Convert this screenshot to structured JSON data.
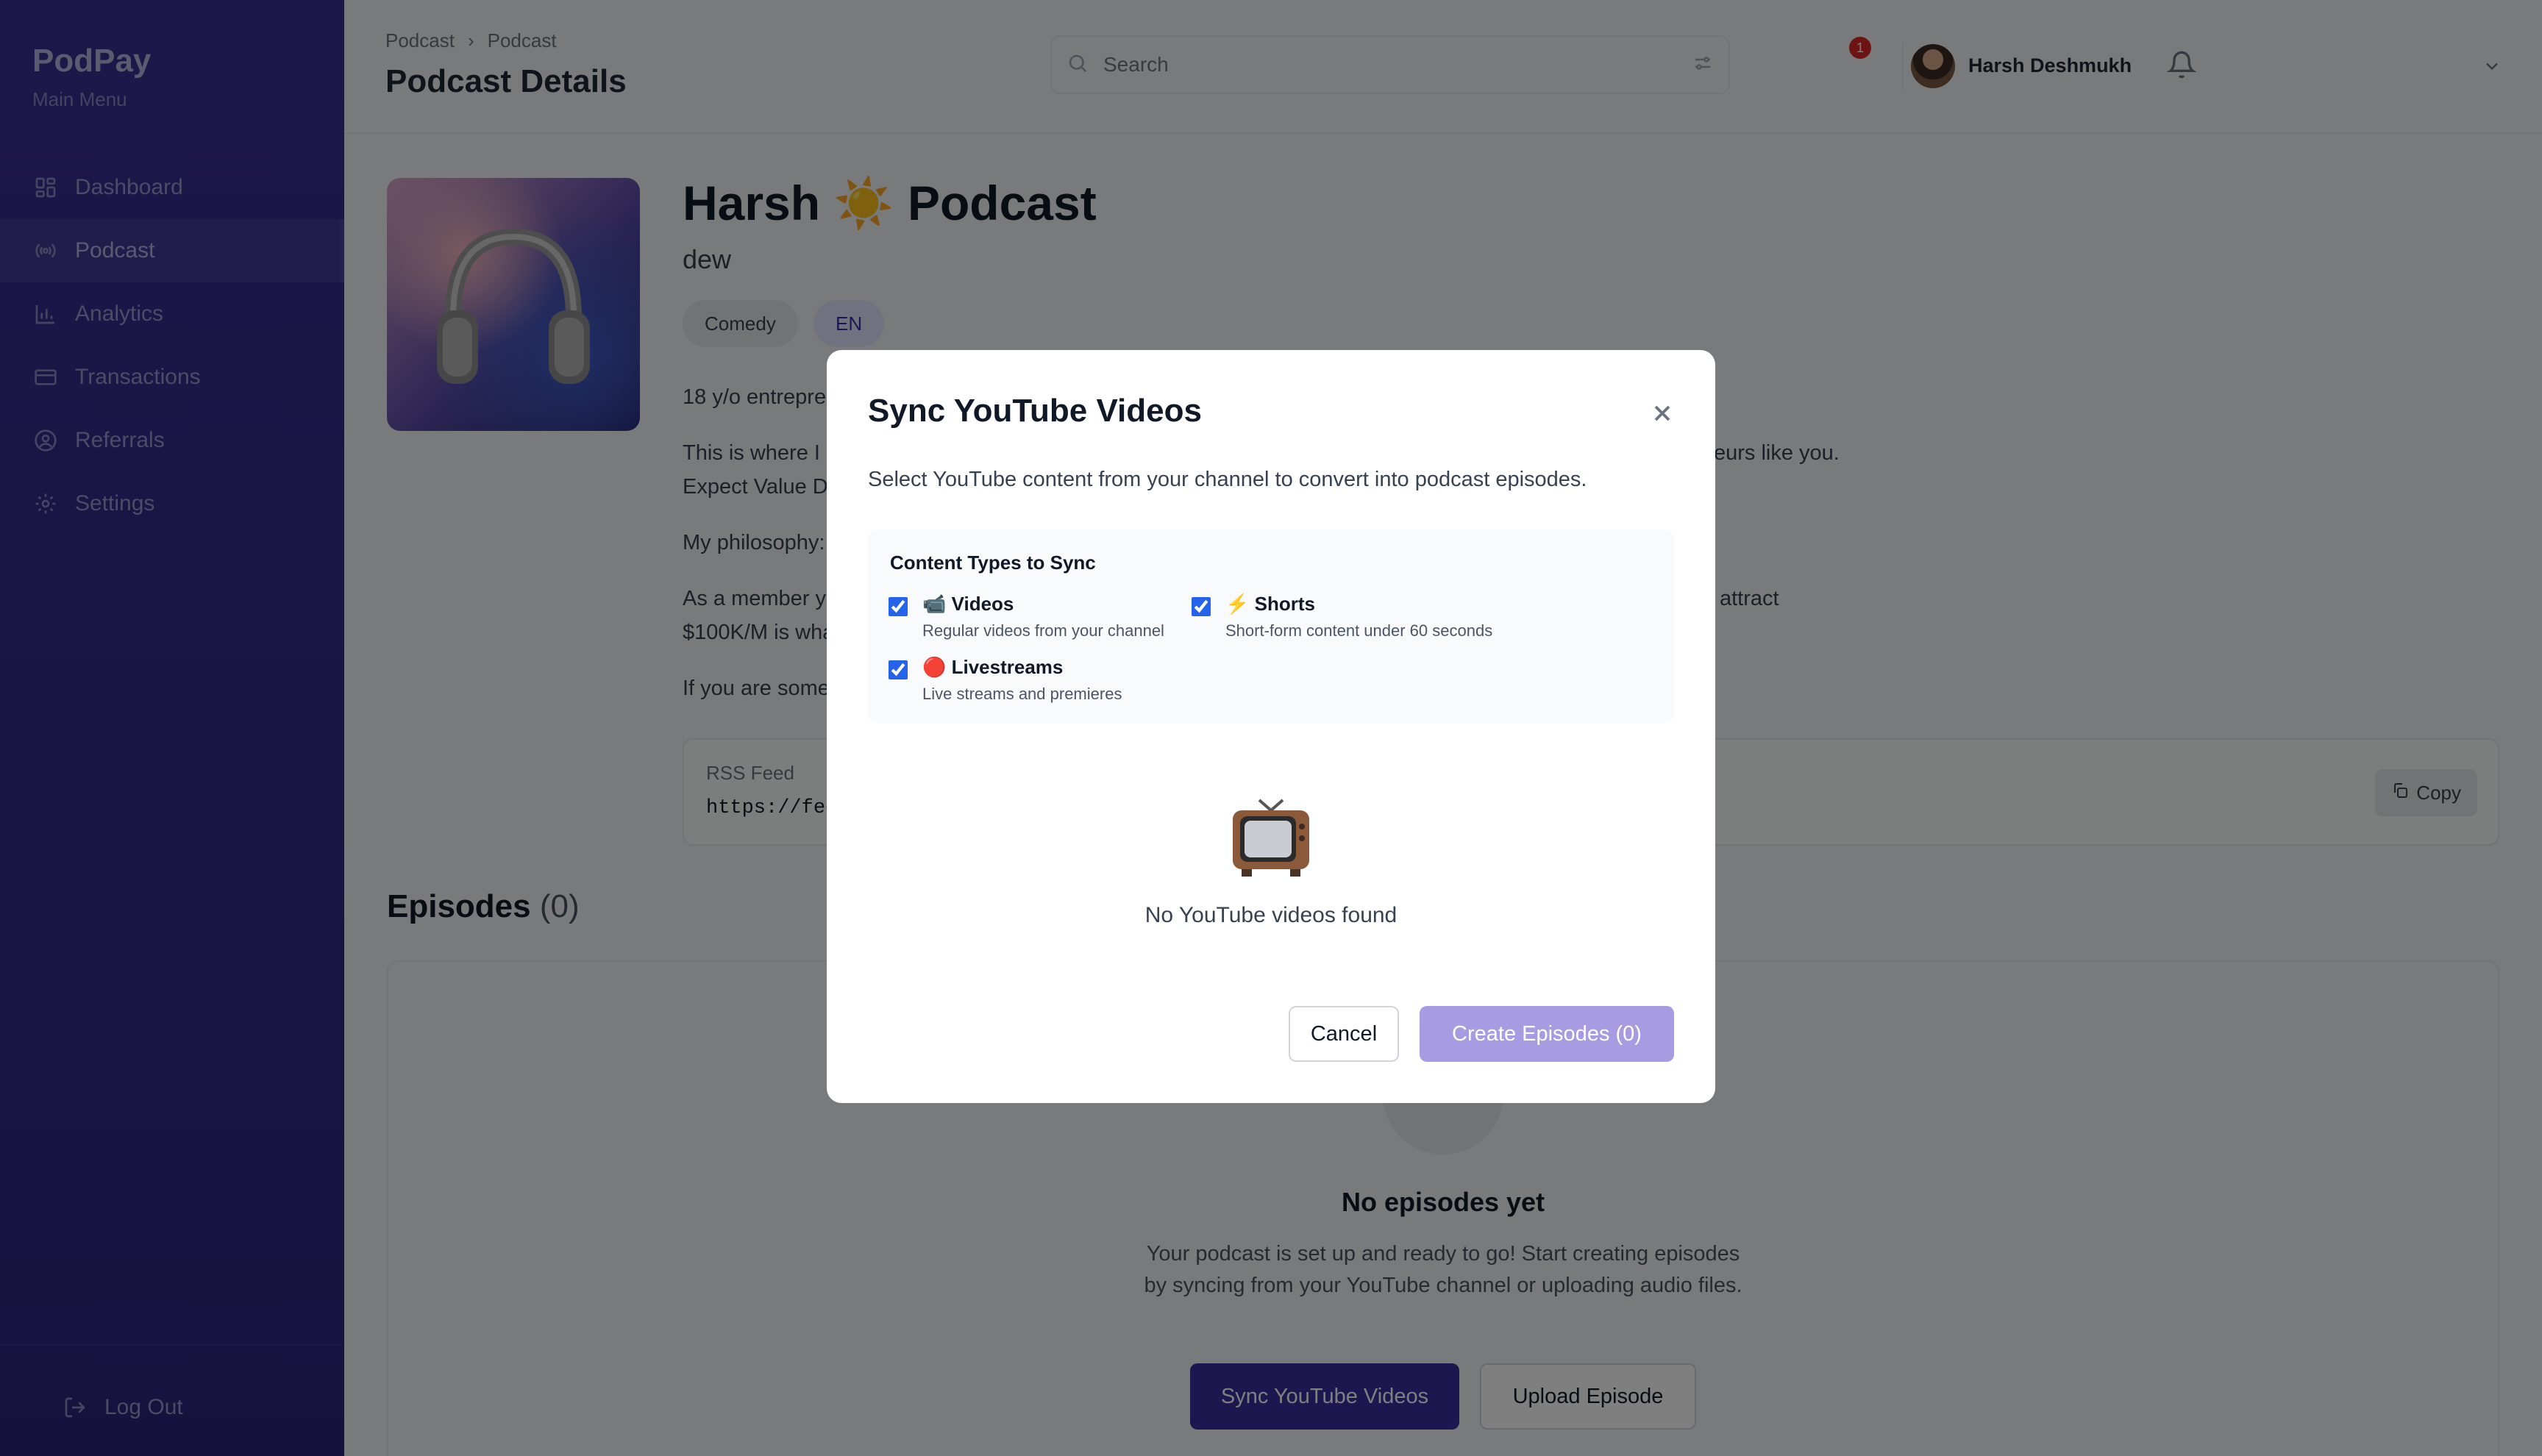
{
  "sidebar": {
    "brand": "PodPay",
    "subtitle": "Main Menu",
    "items": [
      {
        "label": "Dashboard",
        "icon": "dashboard-icon"
      },
      {
        "label": "Podcast",
        "icon": "broadcast-icon"
      },
      {
        "label": "Analytics",
        "icon": "bar-chart-icon"
      },
      {
        "label": "Transactions",
        "icon": "card-icon"
      },
      {
        "label": "Referrals",
        "icon": "user-circle-icon"
      },
      {
        "label": "Settings",
        "icon": "gear-icon"
      }
    ],
    "active_item": "Podcast",
    "logout_label": "Log Out"
  },
  "header": {
    "breadcrumb": [
      "Podcast",
      "Podcast"
    ],
    "breadcrumb_sep": "›",
    "title": "Podcast Details",
    "search_placeholder": "Search",
    "notifications_count": "1",
    "user_name": "Harsh Deshmukh"
  },
  "podcast": {
    "title_left": "Harsh",
    "title_emoji": "☀️",
    "title_right": "Podcast",
    "subtitle": "dew",
    "tags": [
      "Comedy",
      "EN"
    ],
    "desc_lines": [
      {
        "left": "18 y/o entrepre",
        "right": ""
      },
      {
        "left": "This is where I",
        "right": "eurs like you."
      },
      {
        "left": "Expect Value D",
        "right": ""
      },
      {
        "left": "My philosophy:",
        "right": ""
      },
      {
        "left": "As a member y",
        "right": "attract"
      },
      {
        "left": "$100K/M is wha",
        "right": ""
      },
      {
        "left": "If you are some",
        "right": ""
      }
    ],
    "rss_label": "RSS Feed",
    "rss_url": "https://fee",
    "copy_label": "Copy"
  },
  "episodes": {
    "title": "Episodes",
    "count": "(0)",
    "empty_title": "No episodes yet",
    "empty_text": "Your podcast is set up and ready to go! Start creating episodes by syncing from your YouTube channel or uploading audio files.",
    "sync_button": "Sync YouTube Videos",
    "upload_button": "Upload Episode"
  },
  "modal": {
    "title": "Sync YouTube Videos",
    "description": "Select YouTube content from your channel to convert into podcast episodes.",
    "types_title": "Content Types to Sync",
    "options": [
      {
        "emoji": "📹",
        "label": "Videos",
        "hint": "Regular videos from your channel",
        "checked": true
      },
      {
        "emoji": "⚡",
        "label": "Shorts",
        "hint": "Short-form content under 60 seconds",
        "checked": true
      },
      {
        "emoji": "🔴",
        "label": "Livestreams",
        "hint": "Live streams and premieres",
        "checked": true
      }
    ],
    "empty_message": "No YouTube videos found",
    "cancel_label": "Cancel",
    "create_label": "Create Episodes (0)"
  },
  "colors": {
    "sidebar": "#3b2f95",
    "primary": "#3b2fa0",
    "primary_disabled": "#a79ce2",
    "badge": "#dc2626",
    "checkbox": "#2563eb"
  }
}
